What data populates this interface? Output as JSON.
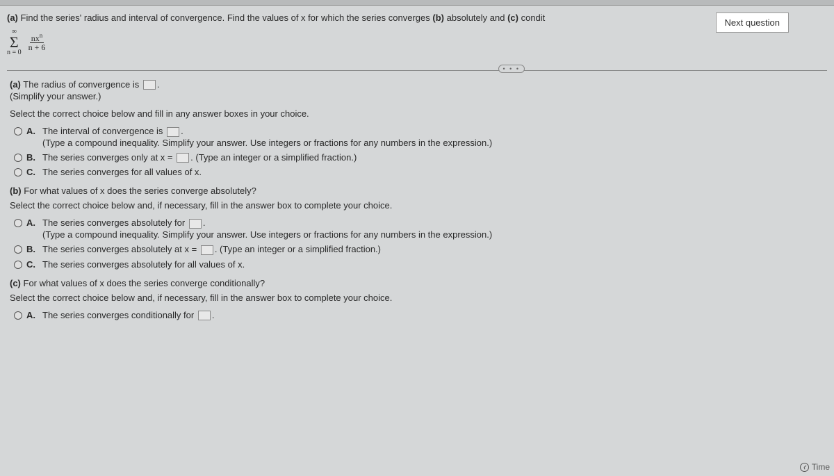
{
  "next_button": "Next question",
  "prompt": {
    "a_label": "(a)",
    "text_1": "Find the series' radius and interval of convergence. Find the values of x for which the series converges",
    "b_label": "(b)",
    "text_2": "absolutely and",
    "c_label": "(c)",
    "text_3": "condit"
  },
  "formula": {
    "sigma_top": "∞",
    "sigma_bottom": "n = 0",
    "numerator": "nx",
    "numerator_sup": "n",
    "denominator": "n + 6"
  },
  "divider_dots": "• • •",
  "part_a": {
    "line1_prefix": "(a)",
    "line1_text": "The radius of convergence is",
    "line1_suffix": ".",
    "line2": "(Simplify your answer.)",
    "instruction": "Select the correct choice below and fill in any answer boxes in your choice.",
    "choices": {
      "A": {
        "label": "A.",
        "text": "The interval of convergence is",
        "suffix": ".",
        "note": "(Type a compound inequality. Simplify your answer. Use integers or fractions for any numbers in the expression.)"
      },
      "B": {
        "label": "B.",
        "text": "The series converges only at x =",
        "suffix": ". (Type an integer or a simplified fraction.)"
      },
      "C": {
        "label": "C.",
        "text": "The series converges for all values of x."
      }
    }
  },
  "part_b": {
    "line1_prefix": "(b)",
    "line1_text": "For what values of x does the series converge absolutely?",
    "instruction": "Select the correct choice below and, if necessary, fill in the answer box to complete your choice.",
    "choices": {
      "A": {
        "label": "A.",
        "text": "The series converges absolutely for",
        "suffix": ".",
        "note": "(Type a compound inequality. Simplify your answer. Use integers or fractions for any numbers in the expression.)"
      },
      "B": {
        "label": "B.",
        "text": "The series converges absolutely at x =",
        "suffix": ". (Type an integer or a simplified fraction.)"
      },
      "C": {
        "label": "C.",
        "text": "The series converges absolutely for all values of x."
      }
    }
  },
  "part_c": {
    "line1_prefix": "(c)",
    "line1_text": "For what values of x does the series converge conditionally?",
    "instruction": "Select the correct choice below and, if necessary, fill in the answer box to complete your choice.",
    "choices": {
      "A": {
        "label": "A.",
        "text": "The series converges conditionally for",
        "suffix": "."
      }
    }
  },
  "time_label": "Time"
}
